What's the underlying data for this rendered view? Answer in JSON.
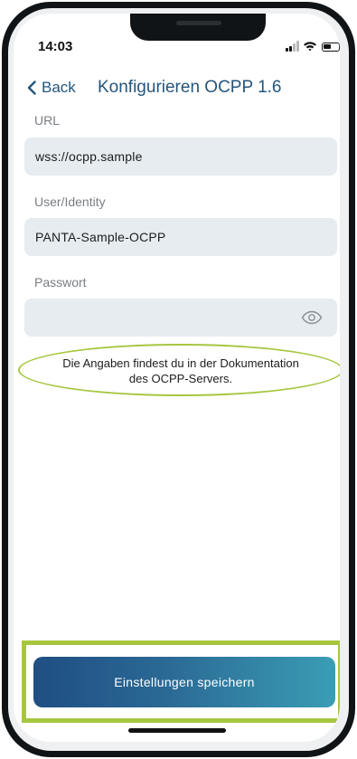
{
  "status_bar": {
    "time": "14:03"
  },
  "nav": {
    "back_label": "Back",
    "title": "Konfigurieren OCPP 1.6"
  },
  "fields": {
    "url": {
      "label": "URL",
      "value": "wss://ocpp.sample"
    },
    "identity": {
      "label": "User/Identity",
      "value": "PANTA-Sample-OCPP"
    },
    "password": {
      "label": "Passwort",
      "value": ""
    }
  },
  "hint": {
    "line1": "Die Angaben findest du in der Dokumentation",
    "line2": "des OCPP-Servers."
  },
  "save_button": {
    "label": "Einstellungen speichern"
  },
  "colors": {
    "accent": "#24567d",
    "highlight": "#a6c640",
    "field_bg": "#e6ecef",
    "button_gradient_start": "#1f4e83",
    "button_gradient_end": "#3a9db5"
  }
}
